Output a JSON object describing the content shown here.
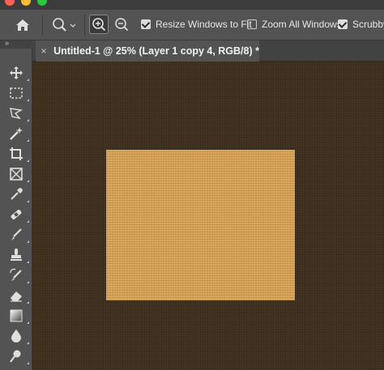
{
  "window": {
    "buttons": [
      "close",
      "minimize",
      "zoom"
    ]
  },
  "options_bar": {
    "home_icon": "home-icon",
    "zoom_tool_icon": "magnifier-icon",
    "zoom_in_icon": "zoom-in-icon",
    "zoom_out_icon": "zoom-out-icon",
    "resize_windows": {
      "label": "Resize Windows to Fit",
      "checked": true
    },
    "zoom_all_windows": {
      "label": "Zoom All Windows",
      "checked": false
    },
    "scrubby_zoom": {
      "label": "Scrubby",
      "checked": true
    }
  },
  "panel": {
    "collapse_glyph": "››"
  },
  "document_tab": {
    "close_glyph": "×",
    "title": "Untitled-1 @ 25% (Layer 1 copy 4, RGB/8) *"
  },
  "toolbar": {
    "tools": [
      "move-tool-icon",
      "marquee-tool-icon",
      "lasso-tool-icon",
      "magic-wand-tool-icon",
      "crop-tool-icon",
      "frame-tool-icon",
      "eyedropper-tool-icon",
      "healing-brush-tool-icon",
      "brush-tool-icon",
      "clone-stamp-tool-icon",
      "history-brush-tool-icon",
      "eraser-tool-icon",
      "gradient-tool-icon",
      "blur-tool-icon",
      "dodge-tool-icon"
    ]
  },
  "colors": {
    "canvas_bg": "#3f3020",
    "document_fill": "#d5a257",
    "ui_panel": "#535353"
  }
}
